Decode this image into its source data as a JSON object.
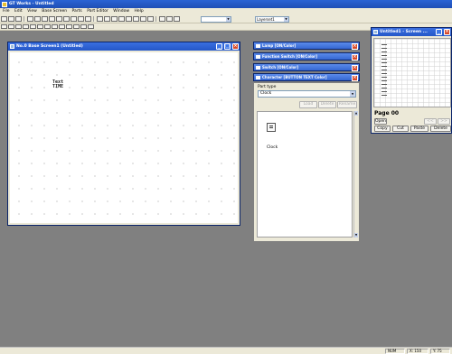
{
  "app": {
    "title": "GT Works - Untitled",
    "menus": [
      "File",
      "Edit",
      "View",
      "Base Screen",
      "Parts",
      "Part Editor",
      "Window",
      "Help"
    ]
  },
  "toolbar": {
    "zoom_value": "",
    "layer_value": "Layerset1"
  },
  "screen_window": {
    "title": "No.0 Base Screen1 (Untitled)",
    "part_label": "Text\nTIME"
  },
  "data_panels": [
    {
      "title": "Lamp [ON/Color]"
    },
    {
      "title": "Function Switch [ON/Color]"
    },
    {
      "title": "Switch [ON/Color]"
    },
    {
      "title": "Character [BUTTON TEXT Color]"
    }
  ],
  "parts_palette": {
    "label": "Part type",
    "selected": "Clock",
    "buttons": [
      "Load",
      "Delete",
      "Rename"
    ],
    "item_label": "Clock"
  },
  "page_window": {
    "title": "Untitled1 - Screen ...",
    "page_label": "Page 00",
    "open_label": "Open",
    "nav_buttons": [
      "<<",
      ">>"
    ],
    "edit_buttons": [
      "Copy",
      "Cut",
      "Paste",
      "Delete"
    ]
  },
  "status": {
    "cells": [
      "NUM",
      "X: 150",
      "Y: 75"
    ]
  },
  "colors": {
    "workspace": "#808080",
    "titlebar": "#2457c8",
    "close": "#d8492a",
    "face": "#ece9d8"
  }
}
